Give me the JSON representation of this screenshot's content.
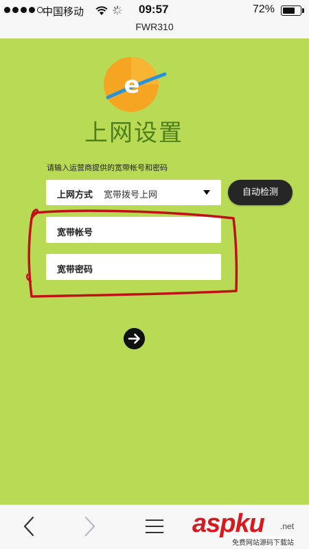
{
  "status_bar": {
    "carrier": "中国移动",
    "time": "09:57",
    "battery_percent": "72%",
    "battery_level": 0.72,
    "signal_bars_filled": 4,
    "signal_bars_total": 5
  },
  "page": {
    "title": "FWR310",
    "heading": "上网设置",
    "hint": "请输入运营商提供的宽带帐号和密码"
  },
  "form": {
    "connection_type_label": "上网方式",
    "connection_type_value": "宽带拨号上网",
    "auto_detect_label": "自动检测",
    "account_placeholder": "宽带帐号",
    "password_placeholder": "宽带密码"
  },
  "icons": {
    "logo": "ie-planet-logo-icon",
    "next": "arrow-right-icon",
    "back": "chevron-left-icon",
    "forward": "chevron-right-icon",
    "menu": "hamburger-icon"
  },
  "watermark": {
    "brand": "aspku",
    "domain": ".net",
    "tagline": "免费网站源码下载站"
  },
  "colors": {
    "background": "#b9da55",
    "heading": "#4d7f1c",
    "button": "#262626",
    "annotation": "#c0101a"
  }
}
